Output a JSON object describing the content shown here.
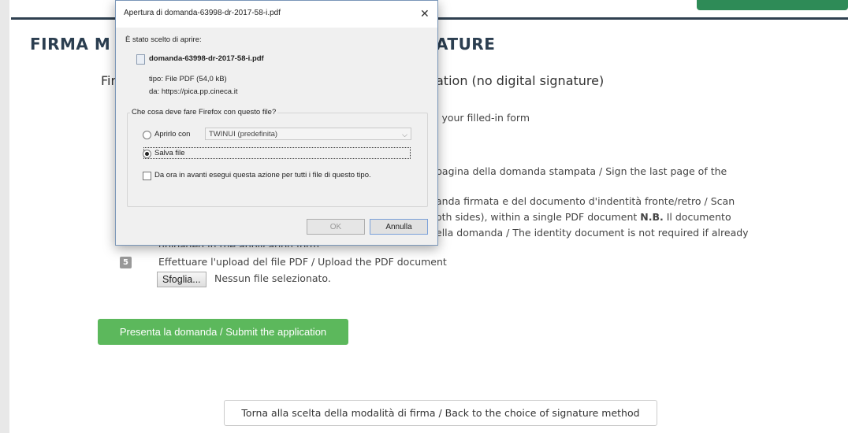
{
  "page": {
    "title_left": "FIRMA M",
    "title_right": "ATURE",
    "subtitle_left": "Fir",
    "subtitle_right": "ation (no digital signature)",
    "line1": "l your filled-in form",
    "line2": "pagina della domanda stampata / Sign the last page of the",
    "line3a": "anda firmata e del documento d'indentità fronte/retro / Scan",
    "line3b_pre": "oth sides), within a single PDF document ",
    "line3b_bold": "N.B.",
    "line3b_post": " Il documento",
    "line3c": "ella domanda / The identity document is not required if already",
    "line3d": "uploaded in the application form",
    "step5_number": "5",
    "step5_text": "Effettuare l'upload del file PDF / Upload the PDF document",
    "browse_label": "Sfoglia...",
    "no_file": "Nessun file selezionato.",
    "submit_label": "Presenta la domanda / Submit the application",
    "back_label": "Torna alla scelta della modalità di firma / Back to the choice of signature method"
  },
  "dialog": {
    "title": "Apertura di domanda-63998-dr-2017-58-i.pdf",
    "close_glyph": "✕",
    "chosen_label": "È stato scelto di aprire:",
    "filename": "domanda-63998-dr-2017-58-i.pdf",
    "type_line": "tipo: File PDF (54,0 kB)",
    "from_line": "da: https://pica.pp.cineca.it",
    "question": "Che cosa deve fare Firefox con questo file?",
    "open_with_label": "Aprirlo con",
    "open_with_app": "TWINUI (predefinita)",
    "save_label": "Salva file",
    "remember_label": "Da ora in avanti esegui questa azione per tutti i file di questo tipo.",
    "ok_label": "OK",
    "cancel_label": "Annulla",
    "selected_option": "Salva file"
  },
  "colors": {
    "accent_green": "#5cb85c",
    "title_navy": "#2b3e50",
    "top_green": "#2e8b57"
  }
}
